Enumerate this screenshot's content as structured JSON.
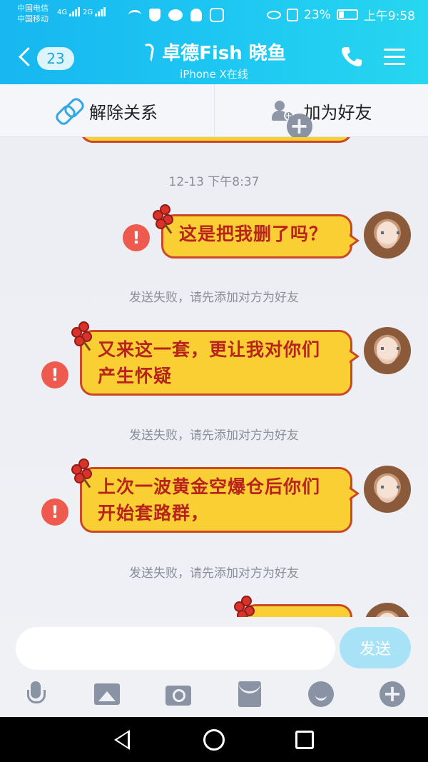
{
  "status_bar": {
    "carrier_1": "中国电信",
    "carrier_2": "中国移动",
    "net_1": "4G",
    "net_2": "2G",
    "battery": "23%",
    "time": "上午9:58"
  },
  "header": {
    "unread_count": "23",
    "contact_name": "卓德Fish 晓鱼",
    "contact_status": "iPhone X在线",
    "icons": [
      "back-arrow-icon",
      "ear-icon",
      "phone-icon",
      "menu-icon"
    ]
  },
  "relation_bar": {
    "remove_label": "解除关系",
    "add_friend_label": "加为好友"
  },
  "chat": {
    "timestamp": "12-13 下午8:37",
    "messages": [
      {
        "lines": [
          "这是把我删了吗？"
        ],
        "status": "!"
      },
      {
        "lines": [
          "又来这一套，更让我对你们",
          "产生怀疑"
        ],
        "status": "!"
      },
      {
        "lines": [
          "上次一波黄金空爆仓后你们",
          "开始套路群，"
        ],
        "status": "!"
      }
    ],
    "fail_notice": "发送失败，请先添加对方为好友",
    "bubble_color": "#f9cf34",
    "text_color": "#b8231b"
  },
  "input": {
    "value": "",
    "send_label": "发送",
    "tool_icons": [
      "microphone-icon",
      "image-icon",
      "camera-icon",
      "red-packet-icon",
      "emoji-icon",
      "plus-icon"
    ]
  },
  "colors": {
    "header_gradient_start": "#17b6f0",
    "header_gradient_end": "#27d6ef",
    "error": "#ee5a4d"
  }
}
